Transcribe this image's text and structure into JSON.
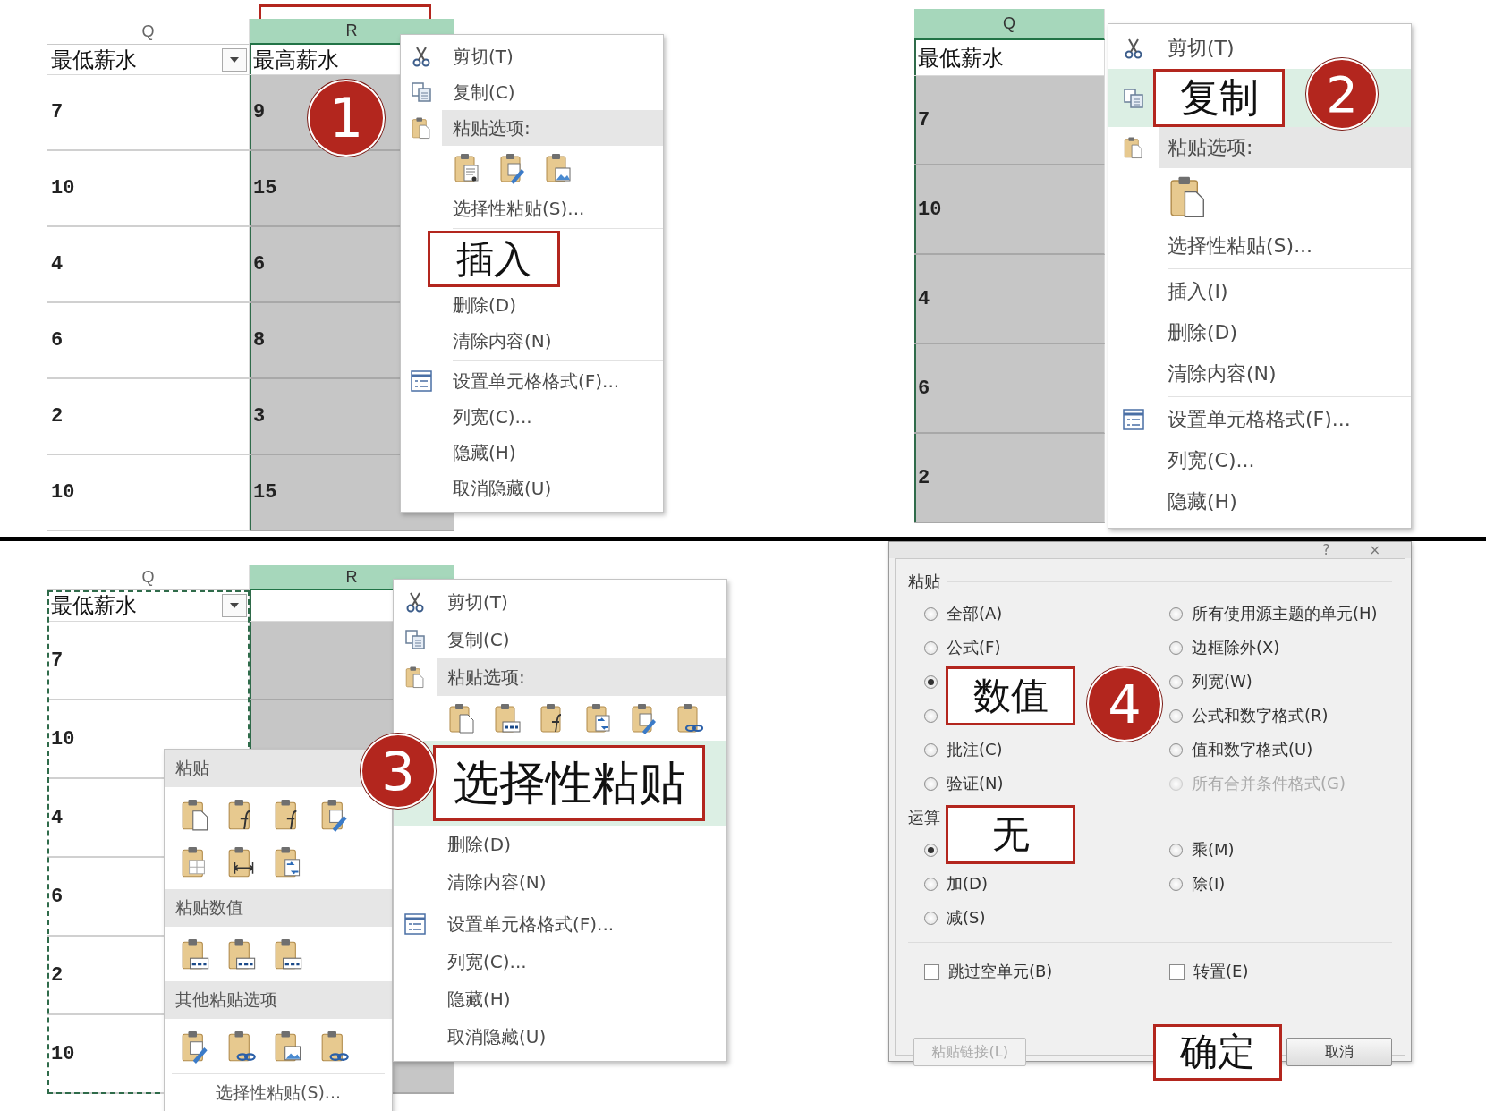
{
  "quadrants": [
    {
      "kind": "sheet",
      "step": "1",
      "columns": [
        {
          "label": "Q",
          "selected": false,
          "copied": false,
          "outlined": false
        },
        {
          "label": "R",
          "selected": true,
          "copied": false,
          "outlined": true
        }
      ],
      "header_cells": [
        {
          "text": "最低薪水",
          "filter": true
        },
        {
          "text": "最高薪水",
          "filter": false
        }
      ],
      "rows": [
        [
          "7",
          "9"
        ],
        [
          "10",
          "15"
        ],
        [
          "4",
          "6"
        ],
        [
          "6",
          "8"
        ],
        [
          "2",
          "3"
        ],
        [
          "10",
          "15"
        ]
      ],
      "menu": {
        "items": [
          {
            "kind": "cut",
            "label": "剪切(T)",
            "callout": false,
            "highlighted": false
          },
          {
            "kind": "copy",
            "label": "复制(C)",
            "callout": false,
            "highlighted": false
          },
          {
            "kind": "paste-heading",
            "label": "粘贴选项:",
            "callout": false,
            "highlighted": false
          },
          {
            "kind": "paste-icons",
            "icons": [
              {
                "kind": "text"
              },
              {
                "kind": "formatting"
              },
              {
                "kind": "picture"
              }
            ]
          },
          {
            "kind": "plain",
            "label": "选择性粘贴(S)...",
            "callout": false,
            "highlighted": false
          },
          {
            "kind": "separator"
          },
          {
            "kind": "plain",
            "label": "插入",
            "callout": true,
            "highlighted": false
          },
          {
            "kind": "plain",
            "label": "删除(D)",
            "callout": false,
            "highlighted": false
          },
          {
            "kind": "plain",
            "label": "清除内容(N)",
            "callout": false,
            "highlighted": false
          },
          {
            "kind": "separator"
          },
          {
            "kind": "format",
            "label": "设置单元格格式(F)...",
            "callout": false,
            "highlighted": false
          },
          {
            "kind": "plain",
            "label": "列宽(C)...",
            "callout": false,
            "highlighted": false
          },
          {
            "kind": "plain",
            "label": "隐藏(H)",
            "callout": false,
            "highlighted": false
          },
          {
            "kind": "plain",
            "label": "取消隐藏(U)",
            "callout": false,
            "highlighted": false
          }
        ]
      }
    },
    {
      "kind": "sheet",
      "step": "2",
      "columns": [
        {
          "label": "Q",
          "selected": true,
          "copied": false,
          "outlined": false
        }
      ],
      "header_cells": [
        {
          "text": "最低薪水",
          "filter": false
        }
      ],
      "rows": [
        [
          "7"
        ],
        [
          "10"
        ],
        [
          "4"
        ],
        [
          "6"
        ],
        [
          "2"
        ]
      ],
      "menu": {
        "items": [
          {
            "kind": "cut",
            "label": "剪切(T)",
            "callout": false,
            "highlighted": false
          },
          {
            "kind": "copy",
            "label": "复制",
            "callout": true,
            "highlighted": true
          },
          {
            "kind": "paste-heading",
            "label": "粘贴选项:",
            "callout": false,
            "highlighted": false
          },
          {
            "kind": "paste-icons",
            "icons": [
              {
                "kind": "page"
              }
            ]
          },
          {
            "kind": "plain",
            "label": "选择性粘贴(S)...",
            "callout": false,
            "highlighted": false
          },
          {
            "kind": "separator"
          },
          {
            "kind": "plain",
            "label": "插入(I)",
            "callout": false,
            "highlighted": false
          },
          {
            "kind": "plain",
            "label": "删除(D)",
            "callout": false,
            "highlighted": false
          },
          {
            "kind": "plain",
            "label": "清除内容(N)",
            "callout": false,
            "highlighted": false
          },
          {
            "kind": "separator"
          },
          {
            "kind": "format",
            "label": "设置单元格格式(F)...",
            "callout": false,
            "highlighted": false
          },
          {
            "kind": "plain",
            "label": "列宽(C)...",
            "callout": false,
            "highlighted": false
          },
          {
            "kind": "plain",
            "label": "隐藏(H)",
            "callout": false,
            "highlighted": false
          }
        ]
      }
    },
    {
      "kind": "sheet",
      "step": "3",
      "columns": [
        {
          "label": "Q",
          "selected": false,
          "copied": true,
          "outlined": false
        },
        {
          "label": "R",
          "selected": true,
          "copied": false,
          "outlined": false
        }
      ],
      "header_cells": [
        {
          "text": "最低薪水",
          "filter": true
        }
      ],
      "rows": [
        [
          "7"
        ],
        [
          "10"
        ],
        [
          "4"
        ],
        [
          "6"
        ],
        [
          "2"
        ],
        [
          "10"
        ]
      ],
      "menu": {
        "items": [
          {
            "kind": "cut",
            "label": "剪切(T)",
            "callout": false,
            "highlighted": false
          },
          {
            "kind": "copy",
            "label": "复制(C)",
            "callout": false,
            "highlighted": false
          },
          {
            "kind": "paste-heading",
            "label": "粘贴选项:",
            "callout": false,
            "highlighted": false
          },
          {
            "kind": "paste-icons",
            "icons": [
              {
                "kind": "page"
              },
              {
                "kind": "values"
              },
              {
                "kind": "formula"
              },
              {
                "kind": "transpose"
              },
              {
                "kind": "formatting"
              },
              {
                "kind": "link"
              }
            ]
          },
          {
            "kind": "plain",
            "label": "选择性粘贴",
            "callout": true,
            "highlighted": true
          },
          {
            "kind": "plain",
            "label": "删除(D)",
            "callout": false,
            "highlighted": false
          },
          {
            "kind": "plain",
            "label": "清除内容(N)",
            "callout": false,
            "highlighted": false
          },
          {
            "kind": "separator"
          },
          {
            "kind": "format",
            "label": "设置单元格格式(F)...",
            "callout": false,
            "highlighted": false
          },
          {
            "kind": "plain",
            "label": "列宽(C)...",
            "callout": false,
            "highlighted": false
          },
          {
            "kind": "plain",
            "label": "隐藏(H)",
            "callout": false,
            "highlighted": false
          },
          {
            "kind": "plain",
            "label": "取消隐藏(U)",
            "callout": false,
            "highlighted": false
          }
        ]
      },
      "flyout": {
        "sections": [
          {
            "title": "粘贴",
            "icons": [
              {
                "kind": "page"
              },
              {
                "kind": "formula"
              },
              {
                "kind": "formula"
              },
              {
                "kind": "formatting"
              },
              {
                "kind": "no-border"
              },
              {
                "kind": "column-width"
              },
              {
                "kind": "transpose"
              }
            ]
          },
          {
            "title": "粘贴数值",
            "icons": [
              {
                "kind": "values"
              },
              {
                "kind": "values"
              },
              {
                "kind": "values"
              }
            ]
          },
          {
            "title": "其他粘贴选项",
            "icons": [
              {
                "kind": "formatting"
              },
              {
                "kind": "link"
              },
              {
                "kind": "picture"
              },
              {
                "kind": "link"
              }
            ]
          }
        ],
        "footer": "选择性粘贴(S)..."
      }
    },
    {
      "kind": "dialog",
      "step": "4",
      "dialog": {
        "title_buttons": [
          "?",
          "×"
        ],
        "groups": [
          {
            "title": "粘贴",
            "options": [
              {
                "label": "全部(A)",
                "selected": false,
                "disabled": false,
                "callout": false
              },
              {
                "label": "所有使用源主题的单元(H)",
                "selected": false,
                "disabled": false,
                "callout": false
              },
              {
                "label": "公式(F)",
                "selected": false,
                "disabled": false,
                "callout": false
              },
              {
                "label": "边框除外(X)",
                "selected": false,
                "disabled": false,
                "callout": false
              },
              {
                "label": "数值",
                "selected": true,
                "disabled": false,
                "callout": true
              },
              {
                "label": "列宽(W)",
                "selected": false,
                "disabled": false,
                "callout": false
              },
              {
                "selected": false,
                "disabled": false
              },
              {
                "label": "公式和数字格式(R)",
                "selected": false,
                "disabled": false,
                "callout": false
              },
              {
                "label": "批注(C)",
                "selected": false,
                "disabled": false,
                "callout": false
              },
              {
                "label": "值和数字格式(U)",
                "selected": false,
                "disabled": false,
                "callout": false
              },
              {
                "label": "验证(N)",
                "selected": false,
                "disabled": false,
                "callout": false
              },
              {
                "label": "所有合并条件格式(G)",
                "selected": false,
                "disabled": true,
                "callout": false
              }
            ]
          },
          {
            "title": "运算",
            "options": [
              {
                "label": "无",
                "selected": true,
                "disabled": false,
                "callout": true
              },
              {
                "label": "乘(M)",
                "selected": false,
                "disabled": false,
                "callout": false
              },
              {
                "label": "加(D)",
                "selected": false,
                "disabled": false,
                "callout": false
              },
              {
                "label": "除(I)",
                "selected": false,
                "disabled": false,
                "callout": false
              },
              {
                "label": "减(S)",
                "selected": false,
                "disabled": false,
                "callout": false
              }
            ]
          }
        ],
        "checkboxes": [
          {
            "label": "跳过空单元(B)",
            "checked": false
          },
          {
            "label": "转置(E)",
            "checked": false
          }
        ],
        "buttons": [
          {
            "label": "粘贴链接(L)",
            "disabled": true,
            "callout": false
          },
          {
            "label": "确定",
            "disabled": false,
            "callout": true
          },
          {
            "label": "取消",
            "disabled": false,
            "callout": false
          }
        ]
      }
    }
  ]
}
